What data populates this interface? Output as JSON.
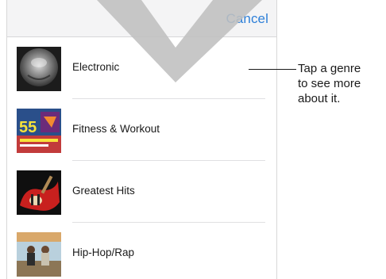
{
  "header": {
    "cancel_label": "Cancel"
  },
  "genres": [
    {
      "label": "Electronic",
      "art": "electronic-album-art"
    },
    {
      "label": "Fitness & Workout",
      "art": "fitness-album-art",
      "art_text": "55"
    },
    {
      "label": "Greatest Hits",
      "art": "greatest-hits-album-art"
    },
    {
      "label": "Hip-Hop/Rap",
      "art": "hip-hop-album-art"
    }
  ],
  "callout": {
    "line1": "Tap a genre",
    "line2": "to see more",
    "line3": "about it."
  },
  "colors": {
    "accent": "#2f80d8",
    "header_bg": "#f4f4f5",
    "overlay": "#bfbfbf"
  }
}
